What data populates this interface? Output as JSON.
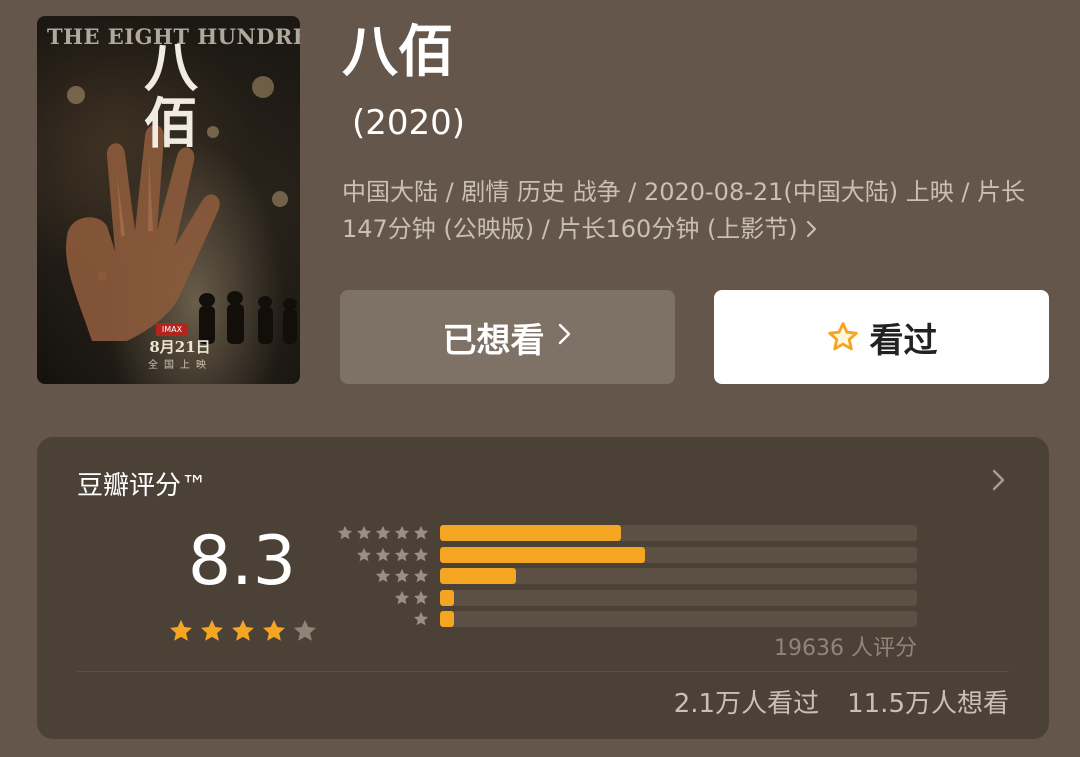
{
  "poster": {
    "english_title": "THE EIGHT HUNDRED",
    "chinese_title": "八佰",
    "tag": "IMAX",
    "date": "8月21日",
    "release": "全国上映"
  },
  "movie": {
    "title": "八佰",
    "year": "(2020)",
    "meta": "中国大陆 / 剧情 历史 战争 / 2020-08-21(中国大陆) 上映 / 片长147分钟 (公映版) / 片长160分钟 (上影节)"
  },
  "actions": {
    "want_label": "已想看",
    "seen_label": "看过"
  },
  "rating": {
    "title": "豆瓣评分™",
    "score": "8.3",
    "stars_filled": 4,
    "stars_total": 5,
    "distribution": [
      {
        "stars": 5,
        "fraction": 0.38
      },
      {
        "stars": 4,
        "fraction": 0.43
      },
      {
        "stars": 3,
        "fraction": 0.16
      },
      {
        "stars": 2,
        "fraction": 0.03
      },
      {
        "stars": 1,
        "fraction": 0.03
      }
    ],
    "count_label": "19636 人评分",
    "seen_count": "2.1万人看过",
    "want_count": "11.5万人想看"
  },
  "colors": {
    "background": "#64564a",
    "card": "#4c4137",
    "accent": "#f4a623",
    "button_secondary": "#7e7266"
  }
}
